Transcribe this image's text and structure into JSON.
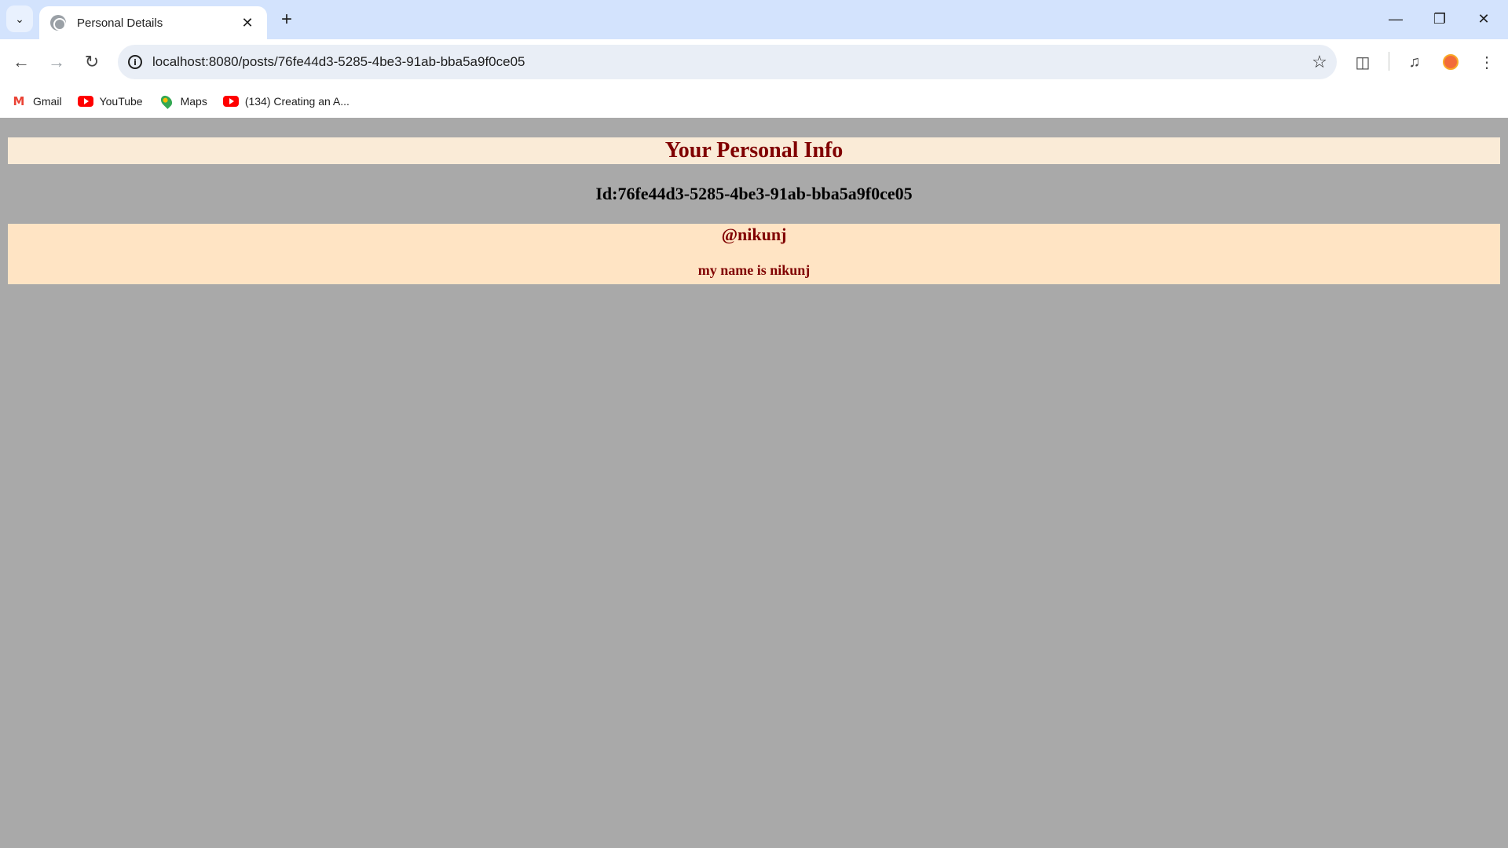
{
  "browser": {
    "tab_title": "Personal Details",
    "url": "localhost:8080/posts/76fe44d3-5285-4be3-91ab-bba5a9f0ce05",
    "bookmarks": [
      {
        "label": "Gmail",
        "icon": "gmail-icon"
      },
      {
        "label": "YouTube",
        "icon": "youtube-icon"
      },
      {
        "label": "Maps",
        "icon": "maps-icon"
      },
      {
        "label": "(134) Creating an A...",
        "icon": "youtube-icon"
      }
    ]
  },
  "page": {
    "heading": "Your Personal Info",
    "id_line": "Id:76fe44d3-5285-4be3-91ab-bba5a9f0ce05",
    "post": {
      "username": "@nikunj",
      "content": "my name is nikunj"
    }
  },
  "colors": {
    "page_background": "#a9a9a9",
    "heading_bar": "#faebd7",
    "post_box": "#ffe4c4",
    "accent_text": "#800000"
  }
}
